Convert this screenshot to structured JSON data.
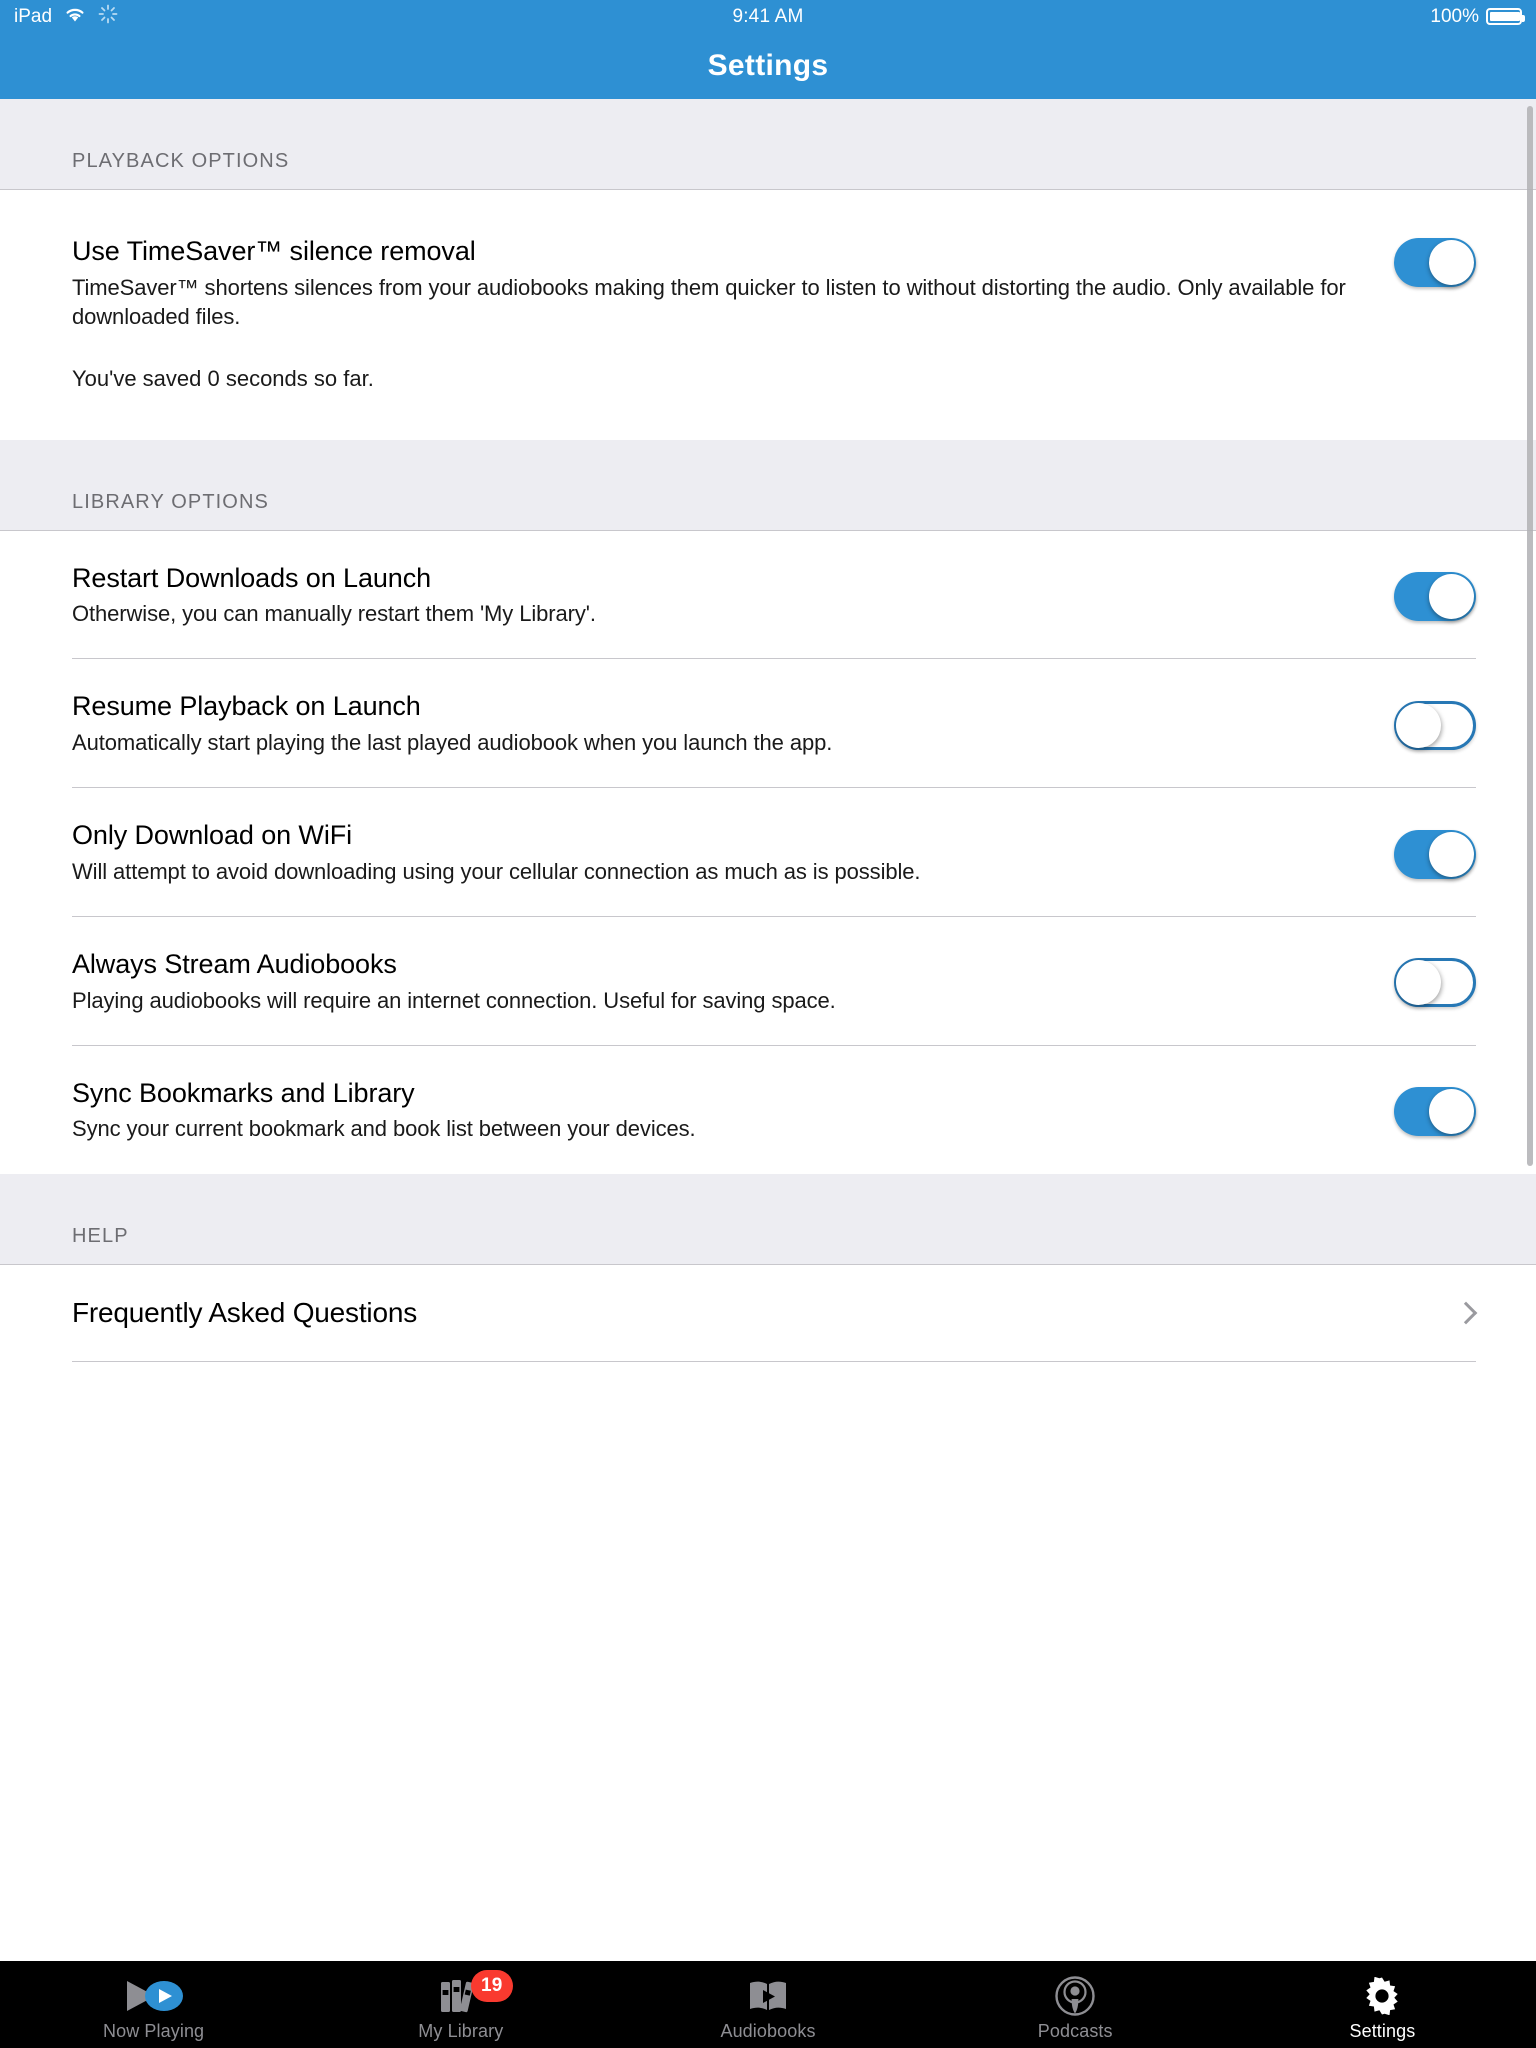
{
  "status_bar": {
    "device": "iPad",
    "wifi_icon": "wifi-icon",
    "activity_icon": "activity-spinner-icon",
    "time": "9:41 AM",
    "battery_percent": "100%",
    "battery_level": 100
  },
  "nav": {
    "title": "Settings"
  },
  "colors": {
    "accent": "#2E90D3",
    "header_bg": "#EDEDF2",
    "header_text": "#6D6D72",
    "badge_red": "#F93A2F",
    "tab_inactive": "#8E8E93",
    "tab_active": "#FFFFFF"
  },
  "sections": [
    {
      "header": "PLAYBACK OPTIONS",
      "rows": [
        {
          "title": "Use TimeSaver™ silence removal",
          "subtitle": "TimeSaver™ shortens silences from your audiobooks making them quicker to listen to without distorting the audio.  Only available for downloaded files.",
          "extra": "You've saved 0 seconds so far.",
          "toggle": "on"
        }
      ]
    },
    {
      "header": "LIBRARY OPTIONS",
      "rows": [
        {
          "title": "Restart Downloads on Launch",
          "subtitle": "Otherwise, you can manually restart them 'My Library'.",
          "toggle": "on"
        },
        {
          "title": "Resume Playback on Launch",
          "subtitle": "Automatically start playing the last played audiobook when you launch the app.",
          "toggle": "off"
        },
        {
          "title": "Only Download on WiFi",
          "subtitle": "Will attempt to avoid downloading using your cellular connection as much as is possible.",
          "toggle": "on"
        },
        {
          "title": "Always Stream Audiobooks",
          "subtitle": "Playing audiobooks will require an internet connection. Useful for saving space.",
          "toggle": "off"
        },
        {
          "title": "Sync Bookmarks and Library",
          "subtitle": "Sync your current bookmark and book list between your devices.",
          "toggle": "on"
        }
      ]
    },
    {
      "header": "HELP",
      "links": [
        {
          "title": "Frequently Asked Questions",
          "accessory": "chevron-right-icon"
        }
      ]
    }
  ],
  "tab_bar": {
    "items": [
      {
        "label": "Now Playing",
        "icon": "now-playing-icon",
        "active": false,
        "badge": null
      },
      {
        "label": "My Library",
        "icon": "books-icon",
        "active": false,
        "badge": "19"
      },
      {
        "label": "Audiobooks",
        "icon": "open-book-play-icon",
        "active": false,
        "badge": null
      },
      {
        "label": "Podcasts",
        "icon": "podcast-icon",
        "active": false,
        "badge": null
      },
      {
        "label": "Settings",
        "icon": "gear-icon",
        "active": true,
        "badge": null
      }
    ]
  }
}
